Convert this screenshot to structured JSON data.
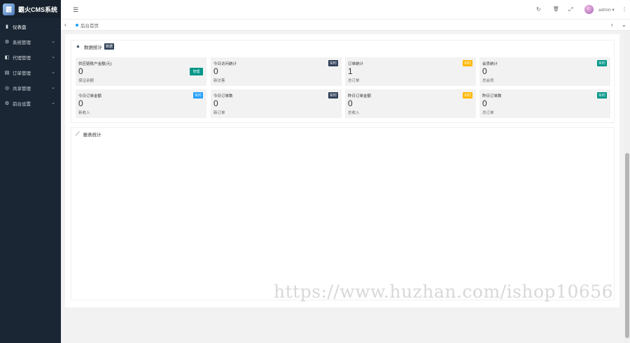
{
  "app": {
    "title": "霸火CMS系统",
    "logo_char": "霸"
  },
  "sidebar": {
    "items": [
      {
        "label": "仪表盘",
        "icon": "▮"
      },
      {
        "label": "系统管理",
        "icon": "⚙"
      },
      {
        "label": "代理管理",
        "icon": "◧"
      },
      {
        "label": "订单管理",
        "icon": "▤"
      },
      {
        "label": "共享管理",
        "icon": "◎"
      },
      {
        "label": "前台设置",
        "icon": "⚙"
      }
    ]
  },
  "topbar": {
    "menu_icon": "☰",
    "refresh_icon": "↻",
    "trash_icon": "🗑",
    "fullscreen_icon": "⤢",
    "username": "admin ▾",
    "more_icon": "⋮"
  },
  "tabs": {
    "prev": "‹",
    "next": "›",
    "dropdown": "⌄",
    "current": "后台首页"
  },
  "stats": {
    "title": "数据统计",
    "title_badge": "数据",
    "cards": [
      {
        "title": "供应链账户金额(元)",
        "value": "0",
        "sub": "保证余额",
        "action": "管理"
      },
      {
        "title": "今日访问统计",
        "value": "0",
        "sub": "新访客",
        "badge": "实时"
      },
      {
        "title": "订单统计",
        "value": "1",
        "sub": "总订单",
        "badge": "实时"
      },
      {
        "title": "会员统计",
        "value": "0",
        "sub": "总会员",
        "badge": "实时"
      },
      {
        "title": "今日订单金额",
        "value": "0",
        "sub": "新收入",
        "badge": "实时"
      },
      {
        "title": "今日订单数",
        "value": "0",
        "sub": "新订单",
        "badge": "实时"
      },
      {
        "title": "昨日订单金额",
        "value": "0",
        "sub": "总收入",
        "badge": "实时"
      },
      {
        "title": "昨日订单数",
        "value": "0",
        "sub": "总订单",
        "badge": "实时"
      }
    ]
  },
  "report": {
    "title": "报表统计",
    "icon": "📈"
  },
  "watermark": "https://www.huzhan.com/ishop10656",
  "colors": {
    "sidebar": "#1a2634",
    "dark": "#2f4056",
    "orange": "#ffb800",
    "green": "#009688",
    "blue": "#1e9fff"
  }
}
